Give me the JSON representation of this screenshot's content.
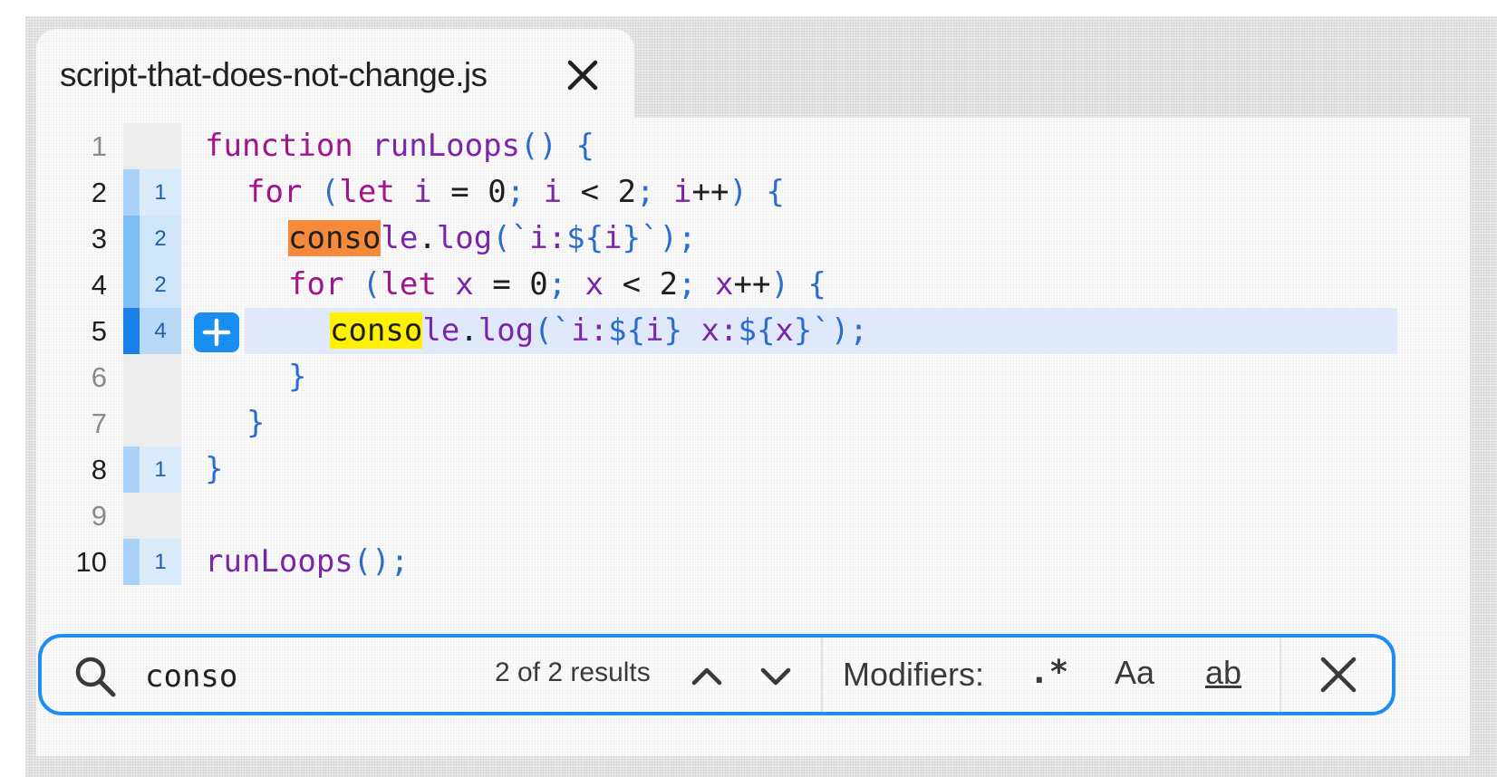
{
  "tab": {
    "title": "script-that-does-not-change.js",
    "close_icon": "close-icon"
  },
  "gutter": {
    "line_numbers": [
      "1",
      "2",
      "3",
      "4",
      "5",
      "6",
      "7",
      "8",
      "9",
      "10"
    ],
    "hit_counts": [
      "",
      "1",
      "2",
      "2",
      "4",
      "",
      "",
      "1",
      "",
      "1"
    ]
  },
  "code": {
    "line1": [
      "function",
      " ",
      "runLoops",
      "()",
      " ",
      "{"
    ],
    "line2": [
      "for",
      " ",
      "(",
      "let",
      " ",
      "i",
      " = ",
      "0",
      ";",
      " ",
      "i",
      " < ",
      "2",
      ";",
      " ",
      "i",
      "++",
      ")",
      " ",
      "{"
    ],
    "line3": [
      "conso",
      "le",
      ".",
      "log",
      "(`",
      "i:",
      "${",
      "i",
      "}`",
      ");"
    ],
    "line4": [
      "for",
      " ",
      "(",
      "let",
      " ",
      "x",
      " = ",
      "0",
      ";",
      " ",
      "x",
      " < ",
      "2",
      ";",
      " ",
      "x",
      "++",
      ")",
      " ",
      "{"
    ],
    "line5": [
      "conso",
      "le",
      ".",
      "log",
      "(`",
      "i:",
      "${",
      "i",
      "}",
      " x:",
      "${",
      "x",
      "}`",
      ");"
    ],
    "line6": "}",
    "line7": "}",
    "line8": "}",
    "line10": [
      "runLoops",
      "();"
    ]
  },
  "search": {
    "icon": "search-icon",
    "query": "conso",
    "results_text": "2 of 2 results",
    "modifiers_label": "Modifiers:",
    "regex_label": ".*",
    "case_label": "Aa",
    "word_label": "ab"
  },
  "colors": {
    "accent": "#1e8df1",
    "current_match": "#f58a3a",
    "other_match": "#fff200",
    "keyword": "#a0148c",
    "identifier": "#7b26a8",
    "punctuation": "#2a6dcc"
  }
}
